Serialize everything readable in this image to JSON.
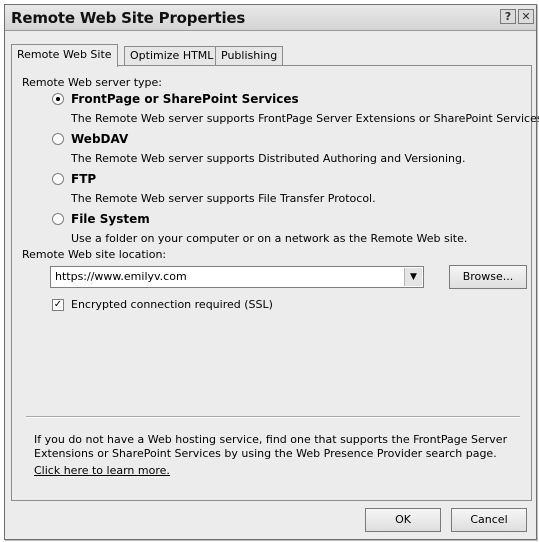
{
  "dialog": {
    "title": "Remote Web Site Properties",
    "help_glyph": "?",
    "close_glyph": "✕"
  },
  "tabs": [
    {
      "label": "Remote Web Site",
      "active": true
    },
    {
      "label": "Optimize HTML",
      "active": false
    },
    {
      "label": "Publishing",
      "active": false
    }
  ],
  "server_type": {
    "label": "Remote Web server type:",
    "selected": "FrontPage or SharePoint Services",
    "options": [
      {
        "label": "FrontPage or SharePoint Services",
        "description": "The Remote Web server supports FrontPage Server Extensions or SharePoint Services."
      },
      {
        "label": "WebDAV",
        "description": "The Remote Web server supports Distributed Authoring and Versioning."
      },
      {
        "label": "FTP",
        "description": "The Remote Web server supports File Transfer Protocol."
      },
      {
        "label": "File System",
        "description": "Use a folder on your computer or on a network as the Remote Web site."
      }
    ]
  },
  "location": {
    "label": "Remote Web site location:",
    "value": "https://www.emilyv.com",
    "browse_label": "Browse..."
  },
  "ssl": {
    "label": "Encrypted connection required (SSL)",
    "checked": true
  },
  "info": {
    "line1": "If you do not have a Web hosting service, find one that supports the FrontPage Server",
    "line2": "Extensions or SharePoint Services by using the Web Presence Provider search page.",
    "link": "Click here to learn more."
  },
  "footer": {
    "ok_label": "OK",
    "cancel_label": "Cancel"
  }
}
